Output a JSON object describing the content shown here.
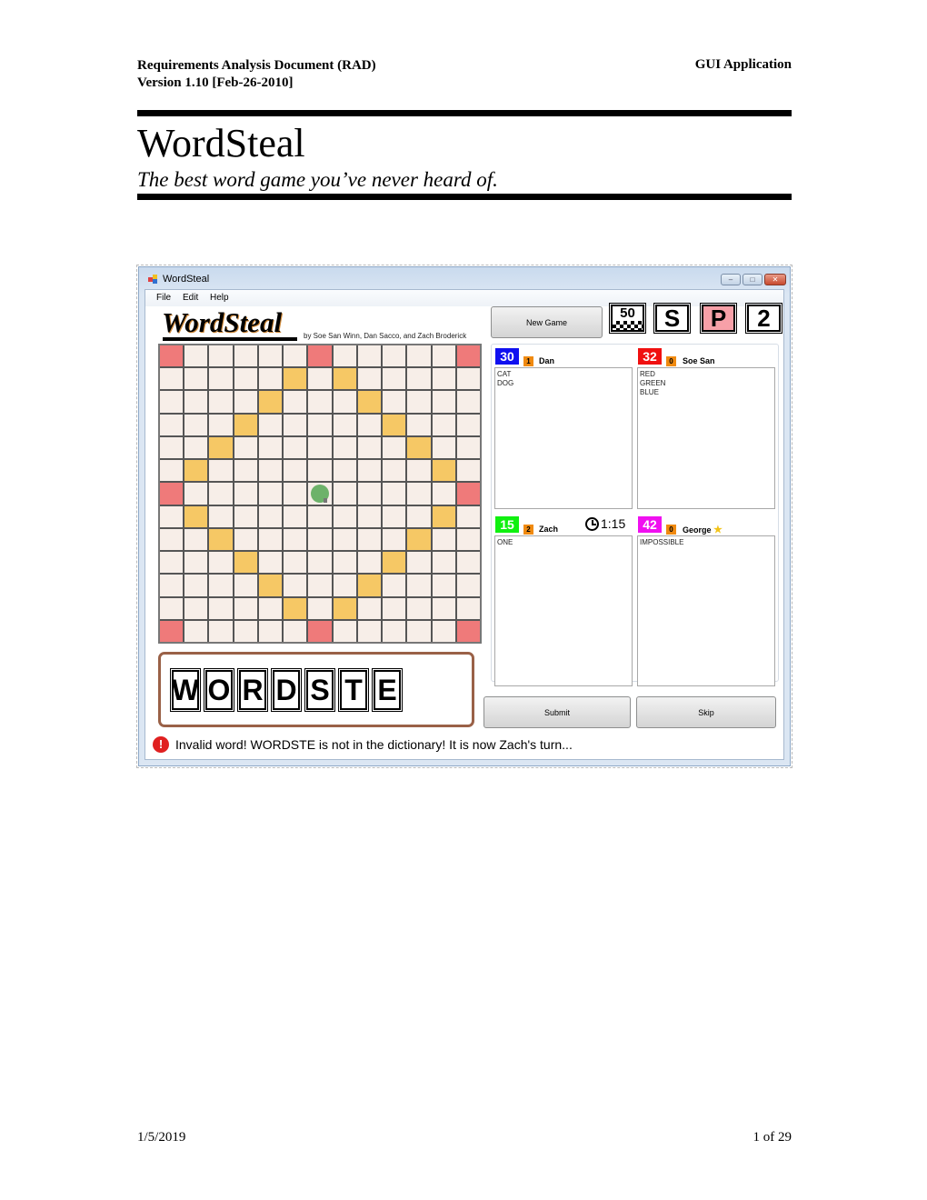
{
  "document": {
    "header_left_line1": "Requirements Analysis Document (RAD)",
    "header_left_line2": "Version 1.10 [Feb-26-2010]",
    "header_right": "GUI Application",
    "title": "WordSteal",
    "subtitle": "The best word game you’ve never heard of.",
    "footer_date": "1/5/2019",
    "footer_page": "1 of 29"
  },
  "window": {
    "title": "WordSteal",
    "controls": {
      "minimize": "–",
      "maximize": "□",
      "close": "✕"
    },
    "menu": [
      "File",
      "Edit",
      "Help"
    ]
  },
  "app": {
    "logo": "WordSteal",
    "byline": "by Soe San Winn, Dan Sacco, and Zach Broderick",
    "new_game_label": "New Game",
    "badges": {
      "target_score": "50",
      "mode_s": "S",
      "mode_p": "P",
      "count": "2"
    },
    "board": {
      "size": 13,
      "red_cells": [
        [
          0,
          0
        ],
        [
          0,
          6
        ],
        [
          0,
          12
        ],
        [
          6,
          0
        ],
        [
          6,
          12
        ],
        [
          12,
          0
        ],
        [
          12,
          6
        ],
        [
          12,
          12
        ]
      ],
      "gold_cells": [
        [
          1,
          5
        ],
        [
          1,
          7
        ],
        [
          2,
          4
        ],
        [
          2,
          8
        ],
        [
          3,
          3
        ],
        [
          3,
          9
        ],
        [
          4,
          2
        ],
        [
          4,
          10
        ],
        [
          5,
          1
        ],
        [
          5,
          11
        ],
        [
          7,
          1
        ],
        [
          7,
          11
        ],
        [
          8,
          2
        ],
        [
          8,
          10
        ],
        [
          9,
          3
        ],
        [
          9,
          9
        ],
        [
          10,
          4
        ],
        [
          10,
          8
        ],
        [
          11,
          5
        ],
        [
          11,
          7
        ]
      ],
      "center_marker": [
        6,
        6
      ]
    },
    "rack_tiles": [
      "W",
      "O",
      "R",
      "D",
      "S",
      "T",
      "E"
    ],
    "players": [
      {
        "score": "30",
        "turns": "1",
        "name": "Dan",
        "color": "#1010f0",
        "words": [
          "CAT",
          "DOG"
        ]
      },
      {
        "score": "32",
        "turns": "0",
        "name": "Soe San",
        "color": "#f01010",
        "words": [
          "RED",
          "GREEN",
          "BLUE"
        ]
      },
      {
        "score": "15",
        "turns": "2",
        "name": "Zach",
        "color": "#10f010",
        "words": [
          "ONE"
        ]
      },
      {
        "score": "42",
        "turns": "0",
        "name": "George",
        "color": "#f010f0",
        "words": [
          "IMPOSSIBLE"
        ],
        "star": "★"
      }
    ],
    "timer": "1:15",
    "submit_label": "Submit",
    "skip_label": "Skip",
    "status_icon": "!",
    "status_message": "Invalid word! WORDSTE is not in the dictionary! It is now Zach's turn..."
  }
}
